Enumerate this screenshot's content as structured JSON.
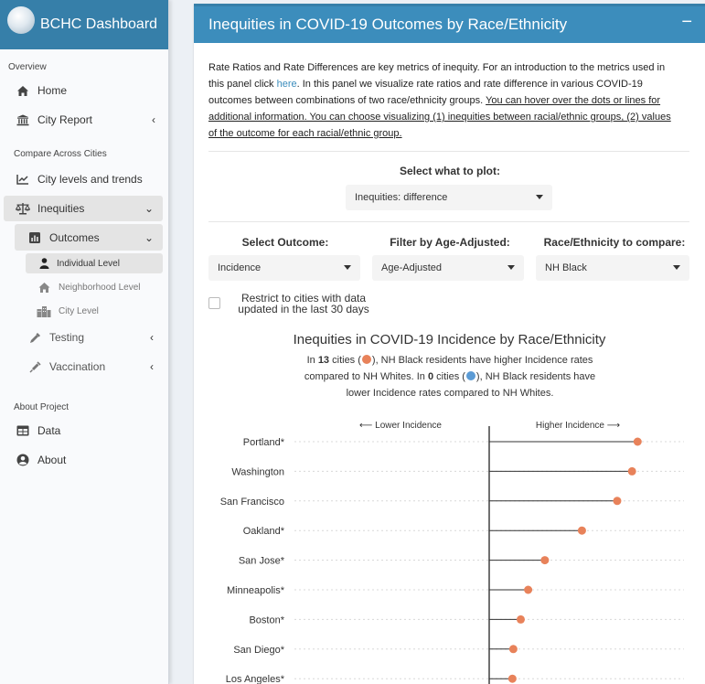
{
  "app": {
    "title": "BCHC Dashboard"
  },
  "sidebar": {
    "overview_header": "Overview",
    "home": "Home",
    "city_report": "City Report",
    "compare_header": "Compare Across Cities",
    "city_levels": "City levels and trends",
    "inequities": "Inequities",
    "outcomes": "Outcomes",
    "individual_level": "Individual Level",
    "neighborhood_level": "Neighborhood Level",
    "city_level": "City Level",
    "testing": "Testing",
    "vaccination": "Vaccination",
    "about_header": "About Project",
    "data": "Data",
    "about": "About"
  },
  "panel": {
    "title": "Inequities in COVID-19 Outcomes by Race/Ethnicity",
    "collapse": "−",
    "intro_part1": "Rate Ratios and Rate Differences are key metrics of inequity. For an introduction to the metrics used in this panel click ",
    "intro_link": "here",
    "intro_part2": ". In this panel we visualize rate ratios and rate difference in various COVID-19 outcomes between combinations of two race/ethnicity groups. ",
    "intro_underlined": "You can hover over the dots or lines for additional information. You can choose visualizing (1) inequities between racial/ethnic groups, (2) values of the outcome for each racial/ethnic group."
  },
  "controls": {
    "plot_label": "Select what to plot:",
    "plot_value": "Inequities: difference",
    "outcome_label": "Select Outcome:",
    "outcome_value": "Incidence",
    "age_label": "Filter by Age-Adjusted:",
    "age_value": "Age-Adjusted",
    "race_label": "Race/Ethnicity to compare:",
    "race_value": "NH Black",
    "restrict_label": "Restrict to cities with data updated in the last 30 days"
  },
  "chart_title": "Inequities in COVID-19 Incidence by Race/Ethnicity",
  "chart_sub": {
    "p1": "In ",
    "n_higher": "13",
    "p2": " cities (",
    "p3": "), NH Black residents have higher Incidence rates compared to NH Whites. In ",
    "n_lower": "0",
    "p4": " cities (",
    "p5": "), NH Black residents have lower Incidence rates compared to NH Whites."
  },
  "colors": {
    "higher": "#e8825a",
    "lower": "#5b9bd5",
    "accent": "#3c8dbc"
  },
  "chart_data": {
    "type": "scatter",
    "left_label": "⟵ Lower Incidence",
    "right_label": "Higher Incidence ⟶",
    "categories": [
      "Portland*",
      "Washington",
      "San Francisco",
      "Oakland*",
      "San Jose*",
      "Minneapolis*",
      "Boston*",
      "San Diego*",
      "Los Angeles*"
    ],
    "values": [
      160,
      154,
      138,
      100,
      60,
      42,
      34,
      26,
      25
    ],
    "xlim": [
      -210,
      210
    ],
    "baseline": 0
  }
}
